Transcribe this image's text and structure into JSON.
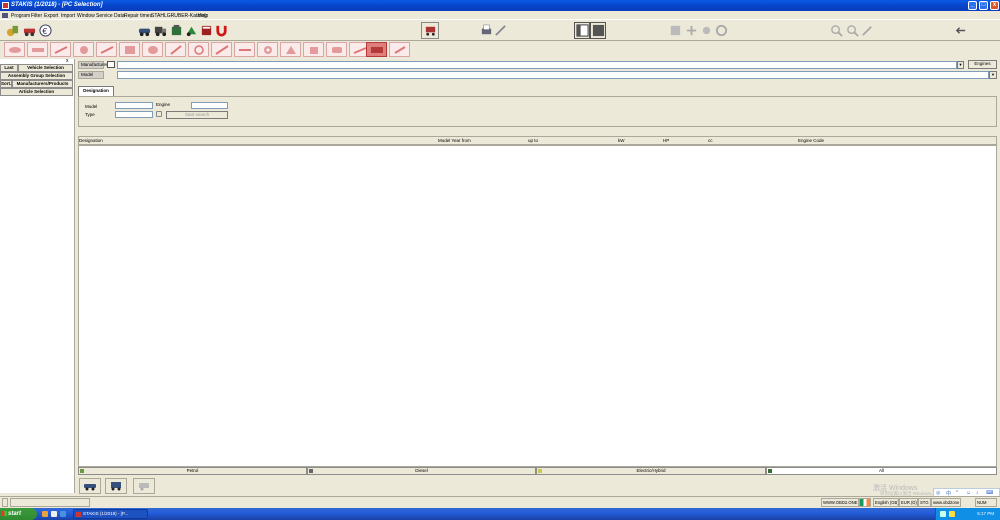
{
  "window": {
    "title": "STAKIS (1/2018) - [PC Selection]",
    "buttons": [
      "_",
      "□",
      "x"
    ]
  },
  "menubar": {
    "items": [
      "Program",
      "Filter",
      "Export",
      "Import",
      "Window",
      "Service Data",
      "Repair times",
      "STAHLGRUBER-Katalog",
      "Help"
    ]
  },
  "left_panel": {
    "last": "Last",
    "vehicle_selection": "Vehicle Selection",
    "assembly_group_selection": "Assembly Group Selection",
    "sort": "Sort.",
    "manufacturers_products": "Manufacturers/Products",
    "article_selection": "Article Selection",
    "close": "x"
  },
  "filters": {
    "manufacturer_label": "Manufacturer",
    "model_label": "Model",
    "engines_button": "Engines",
    "dropdown_arrow": "▾"
  },
  "search": {
    "tab": "Designation",
    "model_label": "Model",
    "type_label": "Type",
    "engine_label": "Engine",
    "start_search": "Start search"
  },
  "results": {
    "columns": [
      "Designation",
      "Model Year from",
      "up to",
      "kW",
      "HP",
      "cc",
      "Engine Code"
    ]
  },
  "fuel_tabs": [
    "Petrol",
    "Diesel",
    "Electric/Hybrid",
    "All"
  ],
  "statusbar": {
    "site": "WWW.OBD2.ONE",
    "language": "English (GB)",
    "currency": "EUR (D)",
    "code": "STG",
    "site2": "www.obd2one",
    "num": "NUM"
  },
  "taskbar": {
    "start": "start",
    "task": "STAKIS (1/2018) - [P...",
    "clock": "5:17 PM"
  },
  "watermark": "激活 Windows",
  "watermark_sub": "转到设置以激活 Windows。",
  "colors": {
    "title_blue": "#0844c8",
    "category_active": "#e07d7d",
    "category_inactive": "#fbeaea",
    "start_green": "#3c9b3c",
    "background": "#ece9d8"
  }
}
